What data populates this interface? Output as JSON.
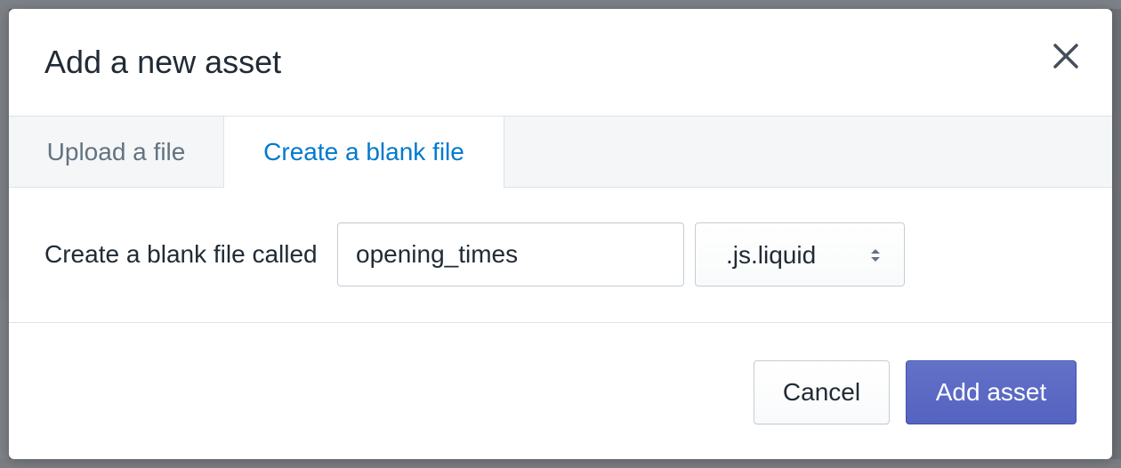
{
  "modal": {
    "title": "Add a new asset",
    "close_icon": "close-icon"
  },
  "tabs": [
    {
      "label": "Upload a file",
      "active": false
    },
    {
      "label": "Create a blank file",
      "active": true
    }
  ],
  "form": {
    "label": "Create a blank file called",
    "filename_value": "opening_times",
    "extension_selected": ".js.liquid",
    "select_icon": "select-arrows-icon"
  },
  "footer": {
    "cancel_label": "Cancel",
    "add_label": "Add asset"
  },
  "colors": {
    "accent_tab": "#007ace",
    "primary_button": "#5c6ac4",
    "title_text": "#212b35",
    "inactive_tab_text": "#637381"
  }
}
